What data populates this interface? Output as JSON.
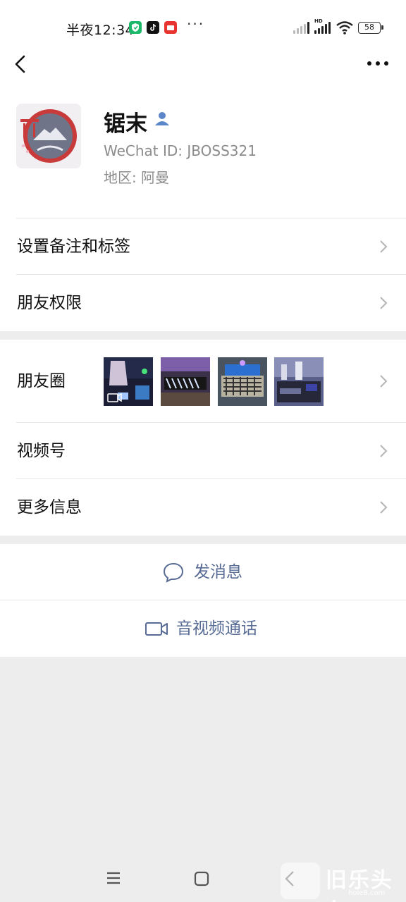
{
  "status_bar": {
    "time": "半夜12:34",
    "battery": "58",
    "network_label": "HD",
    "app_icons": [
      "security-app-icon",
      "tiktok-icon",
      "red-app-icon"
    ],
    "more": "···"
  },
  "nav": {
    "back_icon": "chevron-left-icon",
    "more_icon": "more-dots-icon"
  },
  "profile": {
    "name": "锯末",
    "wechat_id": "WeChat ID:  JBOSS321",
    "region": "地区:  阿曼",
    "verify_icon": "person-icon"
  },
  "rows": {
    "remark": "设置备注和标签",
    "permissions": "朋友权限",
    "moments": "朋友圈",
    "channels": "视频号",
    "more_info": "更多信息"
  },
  "actions": {
    "message": "发消息",
    "call": "音视频通话"
  },
  "watermark": {
    "text": "旧乐头条",
    "sub": "hole8.com",
    "box": "Hole"
  },
  "colors": {
    "link": "#576b95",
    "background": "#ededed",
    "secondary_text": "#8c8c8c"
  }
}
